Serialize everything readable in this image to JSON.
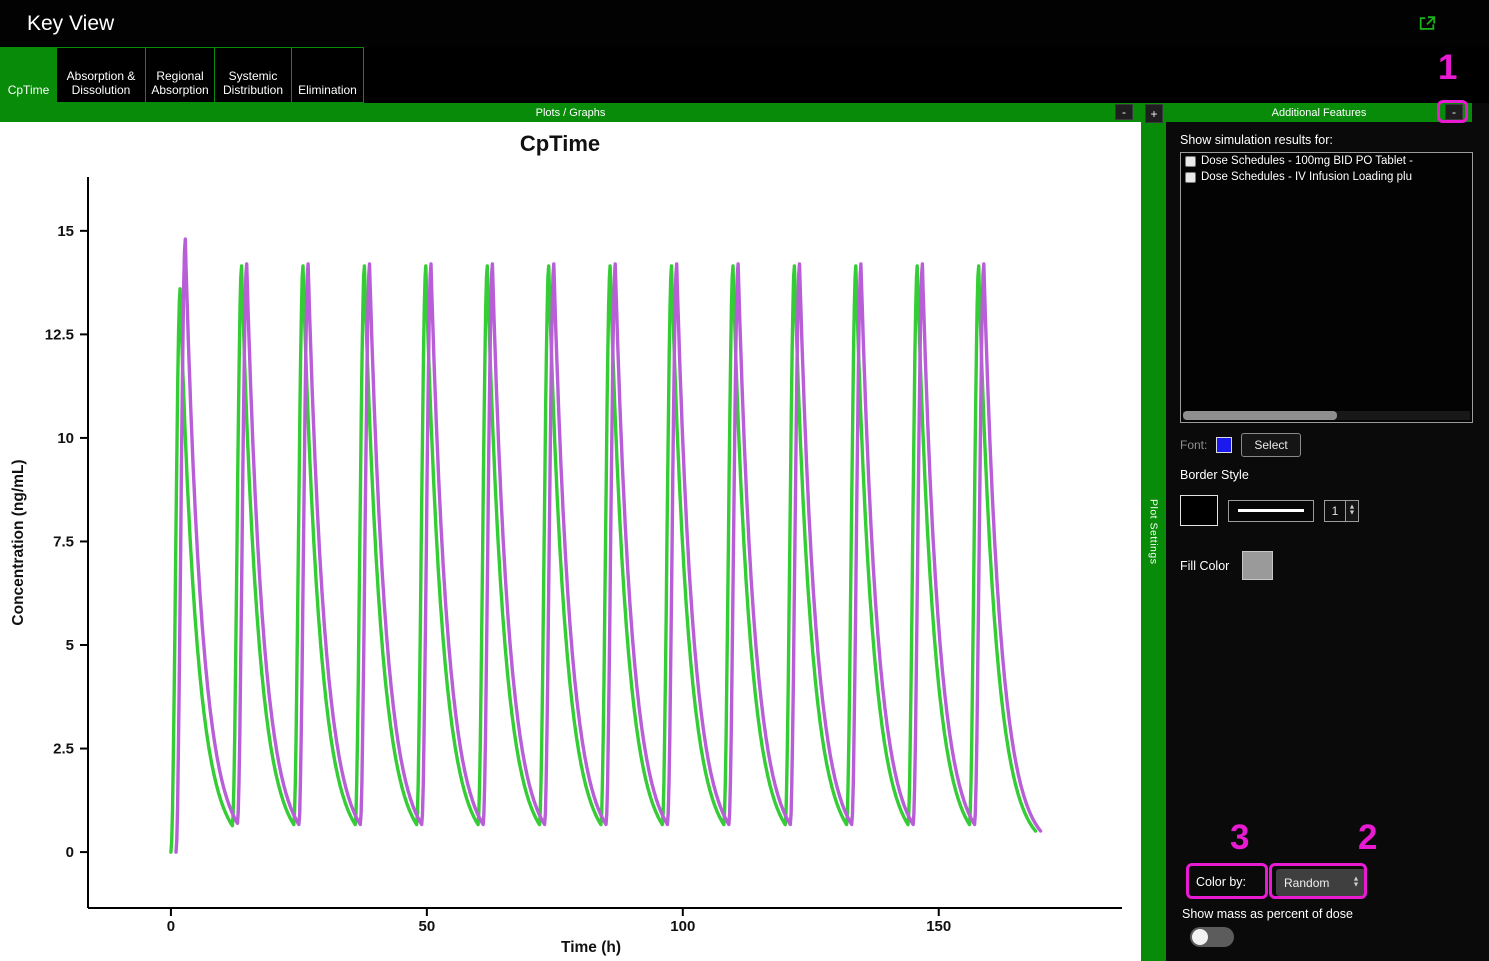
{
  "window": {
    "title": "Key View"
  },
  "tabs": [
    {
      "label": "CpTime",
      "selected": true
    },
    {
      "label": "Absorption & Dissolution",
      "selected": false
    },
    {
      "label": "Regional Absorption",
      "selected": false
    },
    {
      "label": "Systemic Distribution",
      "selected": false
    },
    {
      "label": "Elimination",
      "selected": false
    }
  ],
  "plots_panel": {
    "header": "Plots / Graphs",
    "collapse_label": "-",
    "add_label": "+"
  },
  "plot_settings_strip": {
    "label": "Plot Settings"
  },
  "sidebar": {
    "header": "Additional Features",
    "collapse_label": "-",
    "show_results_label": "Show simulation results for:",
    "result_items": [
      {
        "label": "Dose Schedules - 100mg BID PO Tablet -",
        "checked": false
      },
      {
        "label": "Dose Schedules - IV Infusion Loading plu",
        "checked": false
      }
    ],
    "font_label": "Font:",
    "font_select_label": "Select",
    "border_style_label": "Border Style",
    "border_width_value": "1",
    "fill_color_label": "Fill Color",
    "color_by_label": "Color by:",
    "color_by_value": "Random",
    "mass_toggle_label": "Show mass as percent of dose",
    "mass_toggle_on": false
  },
  "annotations": [
    {
      "number": "1"
    },
    {
      "number": "2"
    },
    {
      "number": "3"
    }
  ],
  "icons": {
    "up_arrow": "▲",
    "down_arrow": "▼"
  },
  "colors": {
    "accent_green": "#088b08",
    "annotation_magenta": "#e81bd2",
    "series_green": "#35cd35",
    "series_purple": "#b85ed7",
    "font_swatch_blue": "#1a1aee",
    "border_swatch_black": "#000000",
    "fill_swatch_gray": "#9a9a9a"
  },
  "chart_data": {
    "type": "line",
    "title": "CpTime",
    "xlabel": "Time (h)",
    "ylabel": "Concentration (ng/mL)",
    "xlim": [
      -16.2,
      185.8
    ],
    "ylim": [
      -1.35,
      16.3
    ],
    "xticks": [
      0,
      50,
      100,
      150
    ],
    "yticks": [
      0,
      2.5,
      5,
      7.5,
      10,
      12.5,
      15
    ],
    "grid": false,
    "legend": "none",
    "dose_times_h": [
      0,
      12,
      24,
      36,
      48,
      60,
      72,
      84,
      96,
      108,
      120,
      132,
      144,
      156
    ],
    "series": [
      {
        "name": "Dose Schedules - 100mg BID PO Tablet -",
        "color": "#35cd35",
        "x_start_h": 0,
        "n_doses": 14,
        "interval_h": 12,
        "t_peak_h": 1.8,
        "first_peak_ng_ml": 13.6,
        "steady_peak_ng_ml": 14.15,
        "trough_ng_ml": 0.7,
        "k_per_h": 0.3,
        "t_end_h": 169
      },
      {
        "name": "Dose Schedules - IV Infusion Loading plu",
        "color": "#b85ed7",
        "x_start_h": 1.0,
        "n_doses": 14,
        "interval_h": 12,
        "t_peak_h": 1.8,
        "first_peak_ng_ml": 14.8,
        "steady_peak_ng_ml": 14.2,
        "trough_ng_ml": 0.72,
        "k_per_h": 0.3,
        "t_end_h": 170
      }
    ]
  }
}
